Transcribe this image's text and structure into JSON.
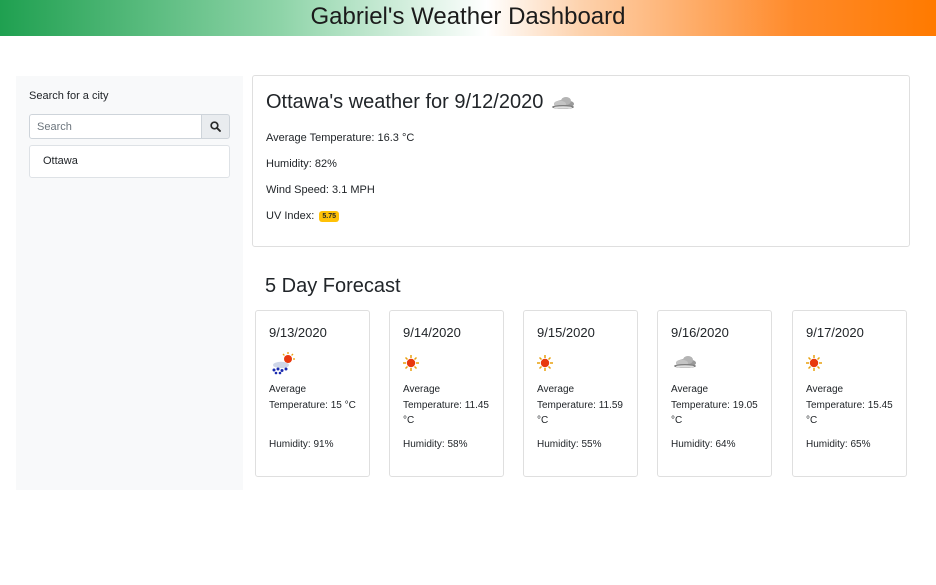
{
  "header": {
    "title": "Gabriel's Weather Dashboard"
  },
  "sidebar": {
    "label": "Search for a city",
    "search_placeholder": "Search",
    "search_icon": "search-icon",
    "cities": [
      "Ottawa"
    ]
  },
  "current": {
    "title": "Ottawa's weather for 9/12/2020",
    "icon": "cloud-icon",
    "temperature": "Average Temperature: 16.3 °C",
    "humidity": "Humidity: 82%",
    "wind": "Wind Speed: 3.1 MPH",
    "uv_label": "UV Index:",
    "uv_value": "5.75",
    "uv_color": "#ffc107"
  },
  "forecast": {
    "title": "5 Day Forecast",
    "days": [
      {
        "date": "9/13/2020",
        "icon": "rain-sun-icon",
        "temp": "Average Temperature: 15 °C",
        "humidity": "Humidity: 91%"
      },
      {
        "date": "9/14/2020",
        "icon": "sun-icon",
        "temp": "Average Temperature: 11.45 °C",
        "humidity": "Humidity: 58%"
      },
      {
        "date": "9/15/2020",
        "icon": "sun-icon",
        "temp": "Average Temperature: 11.59 °C",
        "humidity": "Humidity: 55%"
      },
      {
        "date": "9/16/2020",
        "icon": "cloud-icon",
        "temp": "Average Temperature: 19.05 °C",
        "humidity": "Humidity: 64%"
      },
      {
        "date": "9/17/2020",
        "icon": "sun-icon",
        "temp": "Average Temperature: 15.45 °C",
        "humidity": "Humidity: 65%"
      }
    ]
  },
  "colors": {
    "header_left": "#1fa050",
    "header_right": "#ff7a00",
    "sidebar_bg": "#f8f9fa",
    "sun": "#e8380e"
  }
}
